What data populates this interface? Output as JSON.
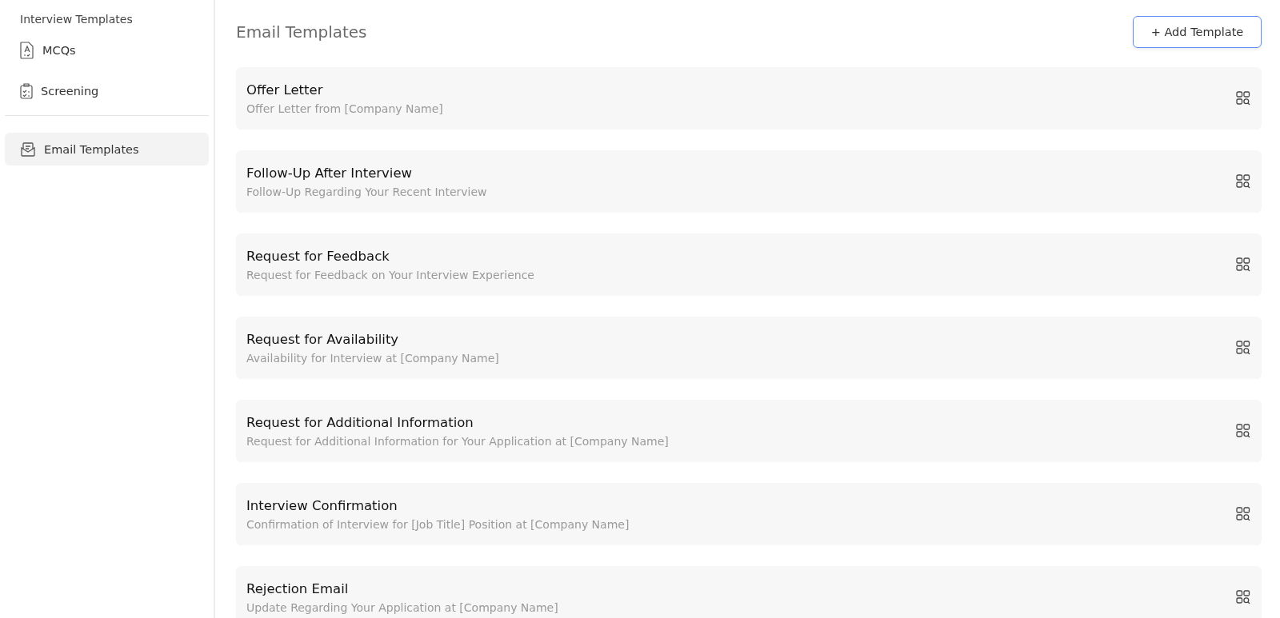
{
  "sidebar": {
    "heading": "Interview Templates",
    "groups": [
      [
        {
          "label": "MCQs",
          "kind": "mcq",
          "selected": false
        },
        {
          "label": "Screening",
          "kind": "screening",
          "selected": false
        }
      ],
      [
        {
          "label": "Email Templates",
          "kind": "email",
          "selected": true
        }
      ]
    ]
  },
  "main": {
    "title": "Email Templates",
    "add_button": "+ Add Template",
    "templates": [
      {
        "title": "Offer Letter",
        "subject": "Offer Letter from [Company Name]"
      },
      {
        "title": "Follow-Up After Interview",
        "subject": "Follow-Up Regarding Your Recent Interview"
      },
      {
        "title": "Request for Feedback",
        "subject": "Request for Feedback on Your Interview Experience"
      },
      {
        "title": "Request for Availability",
        "subject": "Availability for Interview at [Company Name]"
      },
      {
        "title": "Request for Additional Information",
        "subject": "Request for Additional Information for Your Application at [Company Name]"
      },
      {
        "title": "Interview Confirmation",
        "subject": "Confirmation of Interview for [Job Title] Position at [Company Name]"
      },
      {
        "title": "Rejection Email",
        "subject": "Update Regarding Your Application at [Company Name]"
      }
    ]
  }
}
